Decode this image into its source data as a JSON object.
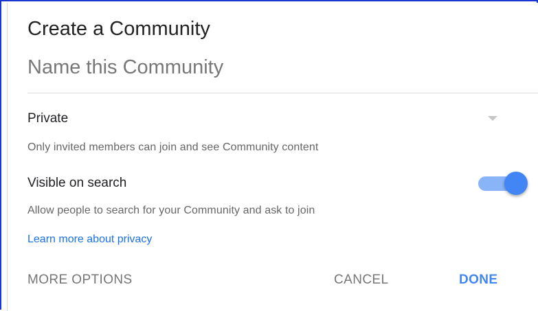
{
  "dialog": {
    "title": "Create a Community",
    "name_placeholder": "Name this Community",
    "name_value": ""
  },
  "privacy": {
    "selected": "Private",
    "description": "Only invited members can join and see Community content",
    "dropdown_icon": "triangle-down-icon"
  },
  "search_visibility": {
    "label": "Visible on search",
    "enabled": true,
    "description": "Allow people to search for your Community and ask to join",
    "toggle_colors": {
      "track": "#8ab4f8",
      "thumb": "#4285f4"
    }
  },
  "learn_more_link": "Learn more about privacy",
  "buttons": {
    "more_options": "MORE OPTIONS",
    "cancel": "CANCEL",
    "done": "DONE"
  },
  "colors": {
    "accent": "#4285f4",
    "link": "#1a73e8",
    "frame_border": "#1a35d6"
  }
}
